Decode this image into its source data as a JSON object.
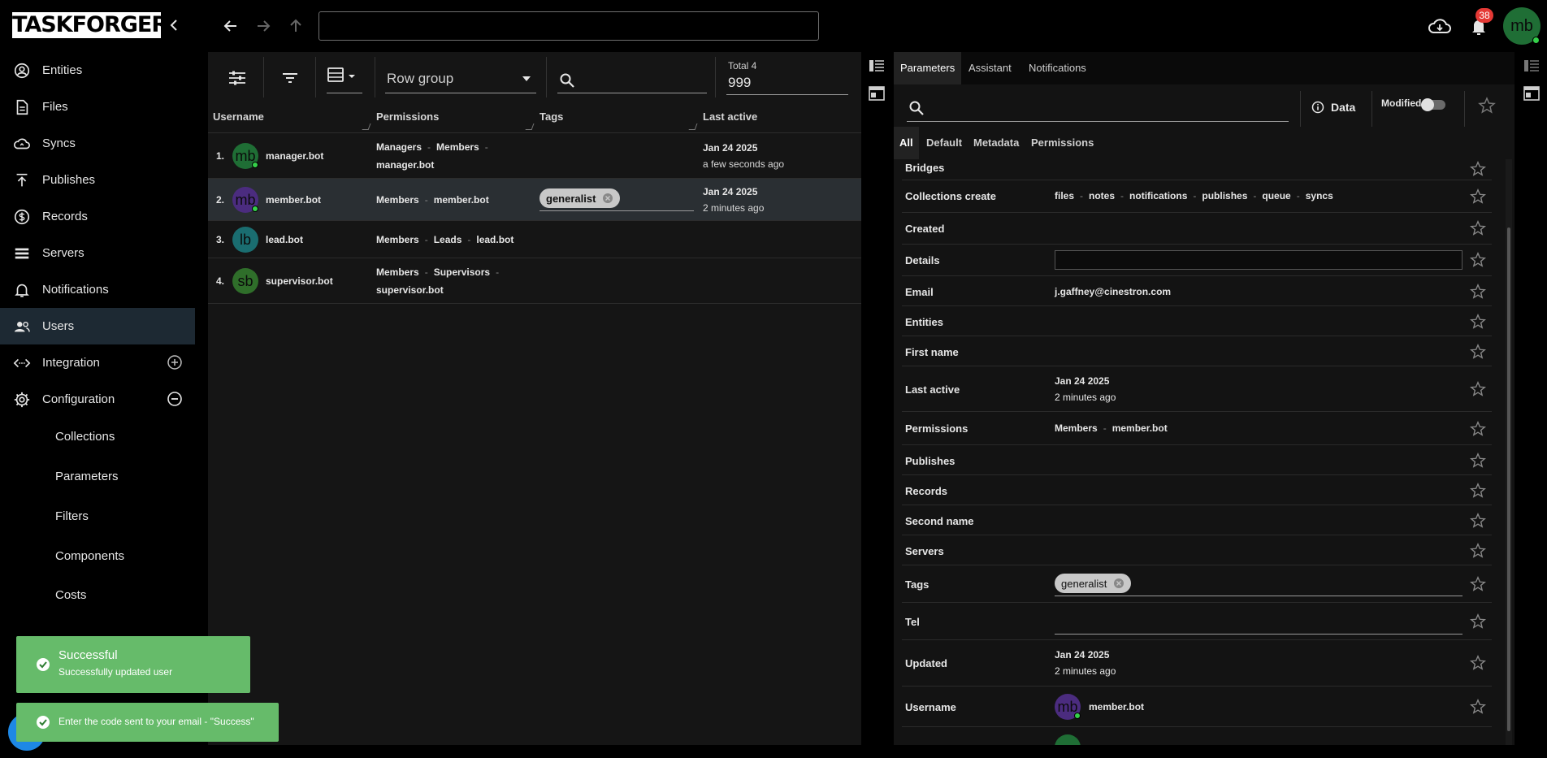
{
  "app": {
    "logo_text": "TASKFORGER"
  },
  "sidebar": {
    "items": [
      {
        "label": "Entities",
        "icon": "entities-icon"
      },
      {
        "label": "Files",
        "icon": "file-icon"
      },
      {
        "label": "Syncs",
        "icon": "cloud-sync-icon"
      },
      {
        "label": "Publishes",
        "icon": "publish-icon"
      },
      {
        "label": "Records",
        "icon": "dollar-icon"
      },
      {
        "label": "Servers",
        "icon": "server-icon"
      },
      {
        "label": "Notifications",
        "icon": "bell-icon"
      },
      {
        "label": "Users",
        "icon": "users-icon",
        "active": true
      },
      {
        "label": "Integration",
        "icon": "code-icon",
        "trailing": "plus-circle-icon"
      },
      {
        "label": "Configuration",
        "icon": "gear-icon",
        "trailing": "minus-circle-icon"
      }
    ],
    "subitems": [
      "Collections",
      "Parameters",
      "Filters",
      "Components",
      "Costs"
    ]
  },
  "topbar": {
    "url_value": "",
    "notification_count": "38",
    "user_initials": "mb"
  },
  "grid": {
    "row_group_label": "Row group",
    "total_label": "Total 4",
    "total_value": "999",
    "columns": [
      "Username",
      "Permissions",
      "Tags",
      "Last active"
    ],
    "rows": [
      {
        "num": "1.",
        "initials": "mb",
        "avatar_color": "#1f6e35",
        "online": true,
        "username": "manager.bot",
        "permissions": [
          "Managers",
          "Members",
          "manager.bot"
        ],
        "tags": [],
        "last_date": "Jan 24 2025",
        "last_rel": "a few seconds ago"
      },
      {
        "num": "2.",
        "initials": "mb",
        "avatar_color": "#4b2c7f",
        "online": true,
        "username": "member.bot",
        "permissions": [
          "Members",
          "member.bot"
        ],
        "tags": [
          "generalist"
        ],
        "last_date": "Jan 24 2025",
        "last_rel": "2 minutes ago"
      },
      {
        "num": "3.",
        "initials": "lb",
        "avatar_color": "#1a6d70",
        "online": false,
        "username": "lead.bot",
        "permissions": [
          "Members",
          "Leads",
          "lead.bot"
        ],
        "tags": [],
        "last_date": "",
        "last_rel": ""
      },
      {
        "num": "4.",
        "initials": "sb",
        "avatar_color": "#2f6e2a",
        "online": false,
        "username": "supervisor.bot",
        "permissions": [
          "Members",
          "Supervisors",
          "supervisor.bot"
        ],
        "tags": [],
        "last_date": "",
        "last_rel": ""
      }
    ]
  },
  "right_panel": {
    "tabs": [
      "Parameters",
      "Assistant",
      "Notifications"
    ],
    "data_label": "Data",
    "modified_label": "Modified",
    "subtabs": [
      "All",
      "Default",
      "Metadata",
      "Permissions"
    ],
    "properties": {
      "bridges": "Bridges",
      "collections_create": {
        "label": "Collections create",
        "values": [
          "files",
          "notes",
          "notifications",
          "publishes",
          "queue",
          "syncs"
        ]
      },
      "created": "Created",
      "details": "Details",
      "email": {
        "label": "Email",
        "value": "j.gaffney@cinestron.com"
      },
      "entities": "Entities",
      "first_name": "First name",
      "last_active": {
        "label": "Last active",
        "date": "Jan 24 2025",
        "rel": "2 minutes ago"
      },
      "permissions": {
        "label": "Permissions",
        "values": [
          "Members",
          "member.bot"
        ]
      },
      "publishes": "Publishes",
      "records": "Records",
      "second_name": "Second name",
      "servers": "Servers",
      "tags": {
        "label": "Tags",
        "chip": "generalist"
      },
      "tel": "Tel",
      "updated": {
        "label": "Updated",
        "date": "Jan 24 2025",
        "rel": "2 minutes ago"
      },
      "username": {
        "label": "Username",
        "initials": "mb",
        "value": "member.bot"
      }
    }
  },
  "toasts": [
    {
      "title": "Successful",
      "message": "Successfully updated user"
    },
    {
      "title": "",
      "message": "Enter the code sent to your email - \"Success\""
    }
  ],
  "colors": {
    "sidebar_active": "#1d2933",
    "toast_green": "#66bb6a",
    "badge_red": "#e53935",
    "online_dot": "#35d04a"
  }
}
